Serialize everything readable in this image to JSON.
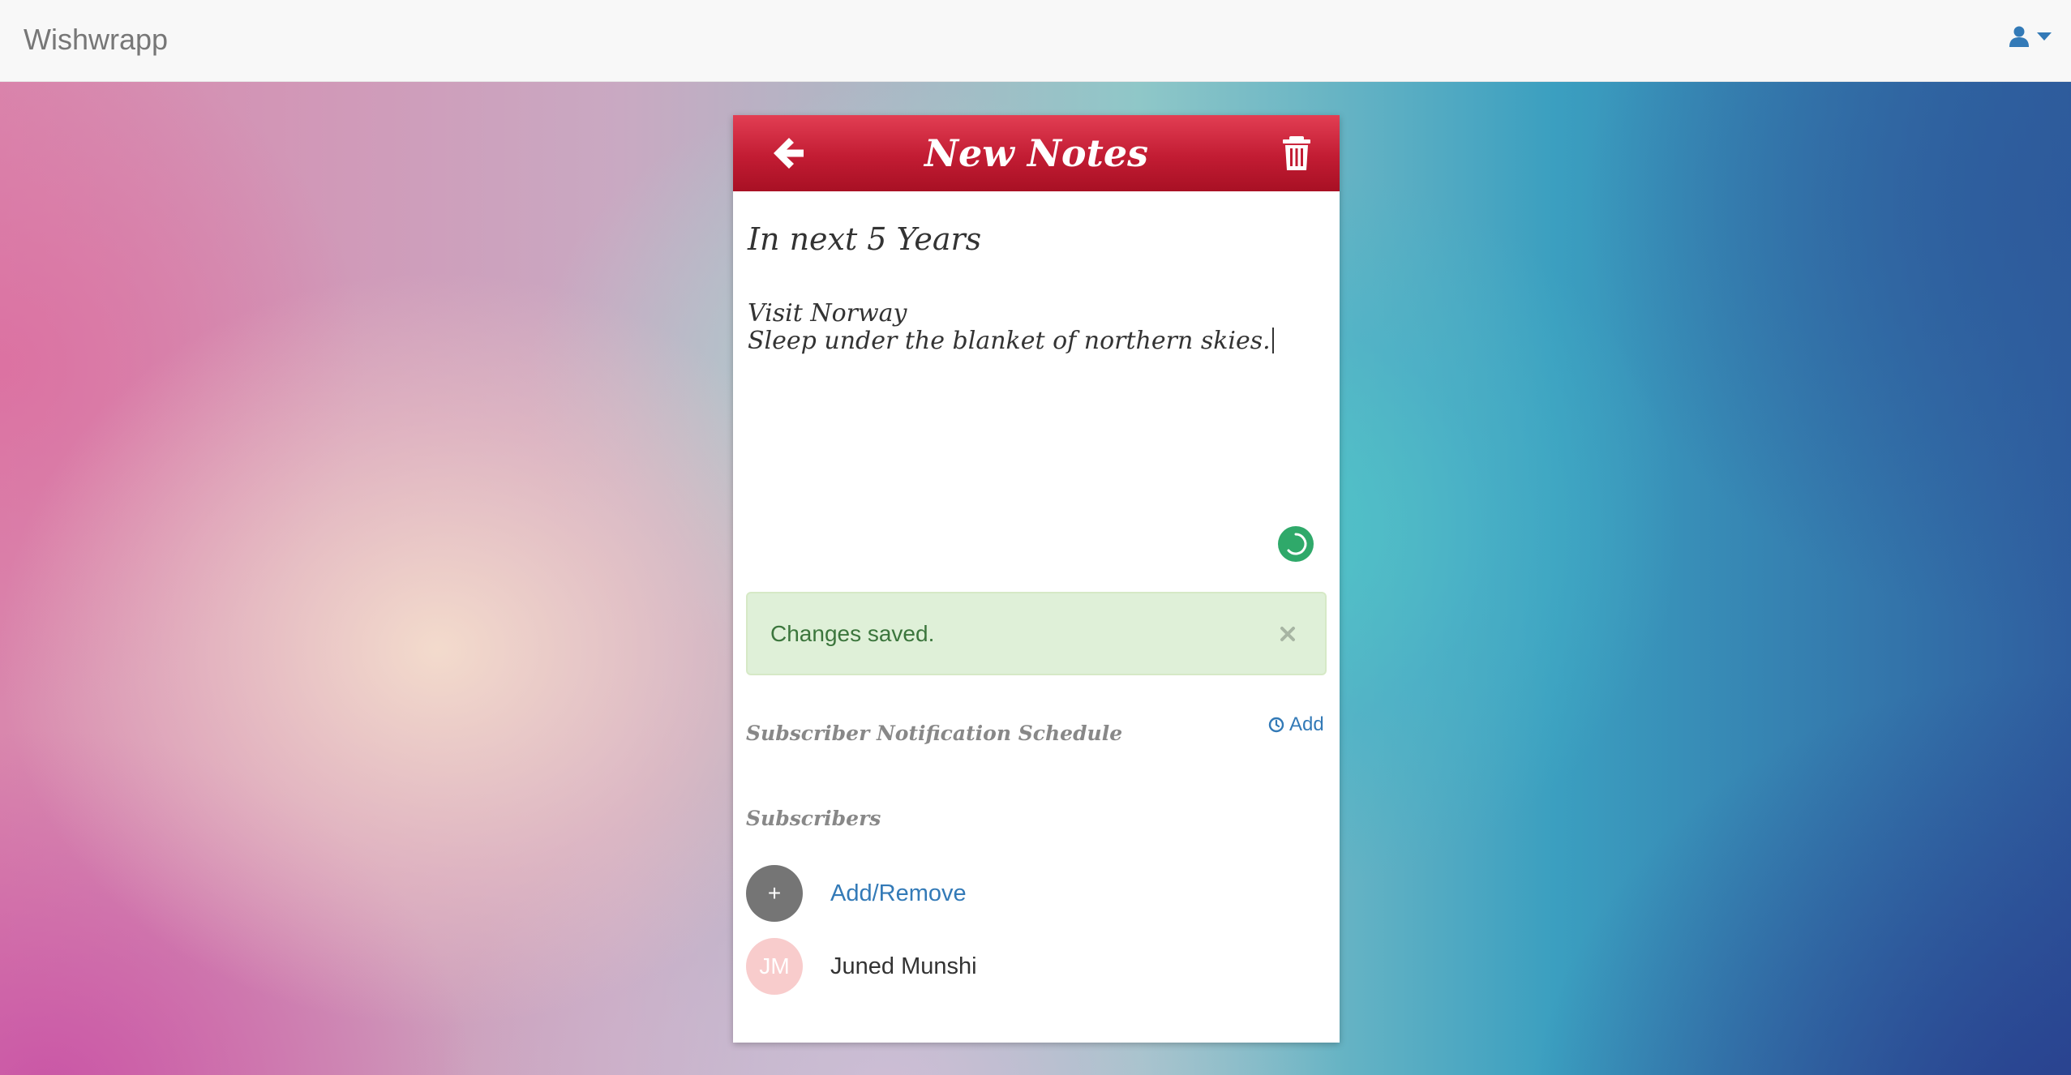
{
  "navbar": {
    "brand": "Wishwrapp",
    "user_icon": "user-icon",
    "caret_icon": "caret-down-icon"
  },
  "card": {
    "header": {
      "title": "New Notes",
      "back_icon": "arrow-left-icon",
      "delete_icon": "trash-icon",
      "color": "#c21c33"
    },
    "note": {
      "title": "In next 5 Years",
      "body_lines": [
        "Visit Norway",
        "Sleep under the blanket of northern skies."
      ]
    },
    "status_icon": "spinner-icon",
    "alert": {
      "text": "Changes saved.",
      "close_label": "×"
    },
    "schedule": {
      "label": "Subscriber Notification Schedule",
      "add_label": "Add",
      "add_icon": "clock-icon"
    },
    "subscribers": {
      "label": "Subscribers",
      "add_remove_symbol": "+",
      "add_remove_label": "Add/Remove",
      "items": [
        {
          "initials": "JM",
          "name": "Juned Munshi"
        }
      ]
    }
  },
  "colors": {
    "accent_link": "#337ab7",
    "success_bg": "#dff0d8",
    "success_text": "#3c763d"
  }
}
